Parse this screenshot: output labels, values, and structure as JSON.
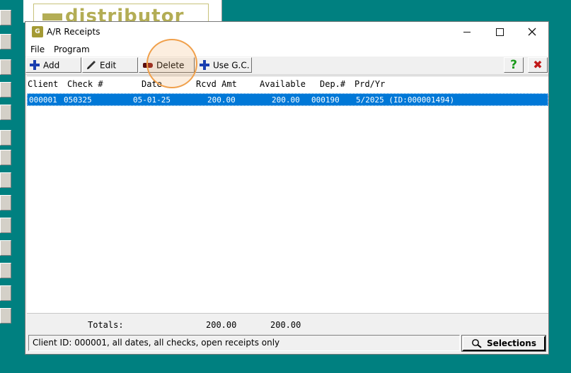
{
  "background_logo_text": "distributor",
  "window": {
    "title": "A/R Receipts",
    "app_icon_text": "G"
  },
  "menu": [
    "File",
    "Program"
  ],
  "toolbar": {
    "add_label": "Add",
    "edit_label": "Edit",
    "delete_label": "Delete",
    "use_gc_label": "Use G.C.",
    "help_glyph": "?",
    "close_glyph": "✖"
  },
  "table": {
    "headers": {
      "client": "Client",
      "check": "Check #",
      "date": "Date",
      "rcvd": "Rcvd Amt",
      "available": "Available",
      "dep": "Dep.#",
      "prd": "Prd/Yr"
    },
    "rows": [
      {
        "client": "000001",
        "check": "050325",
        "date": "05-01-25",
        "rcvd": "200.00",
        "available": "200.00",
        "dep": "000190",
        "prd": "5/2025 (ID:000001494)"
      }
    ]
  },
  "totals": {
    "label": "Totals:",
    "rcvd": "200.00",
    "available": "200.00"
  },
  "status_text": "Client ID: 000001, all dates, all checks, open receipts only",
  "selections_label": "Selections",
  "colors": {
    "selection": "#0078d7",
    "desktop": "#008080",
    "highlight": "#f0a04b"
  }
}
